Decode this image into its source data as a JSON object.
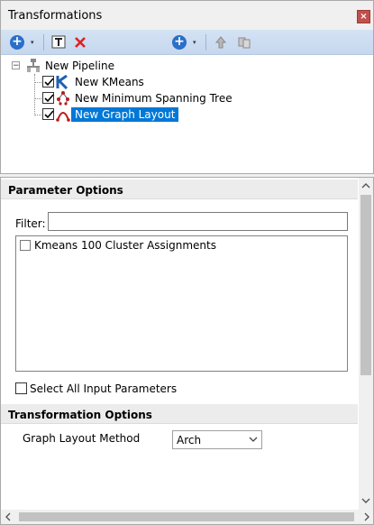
{
  "window": {
    "title": "Transformations",
    "close_glyph": "×"
  },
  "toolbar": {
    "add_glyph": "+",
    "dropdown_glyph": "▾",
    "icons": [
      "add-transformation-icon",
      "rename-icon",
      "delete-icon",
      "add-step-icon",
      "move-up-icon",
      "move-down-icon"
    ]
  },
  "tree": {
    "root": {
      "label": "New Pipeline",
      "expander": "−"
    },
    "items": [
      {
        "label": "New KMeans",
        "checked": true,
        "icon": "kmeans-icon"
      },
      {
        "label": "New Minimum Spanning Tree",
        "checked": true,
        "icon": "mst-icon"
      },
      {
        "label": "New Graph Layout",
        "checked": true,
        "icon": "graph-layout-icon",
        "selected": true
      }
    ]
  },
  "parameter_options": {
    "header": "Parameter Options",
    "filter_label": "Filter:",
    "filter_value": "",
    "list_items": [
      {
        "label": "Kmeans 100 Cluster Assignments",
        "checked": false
      }
    ],
    "select_all_label": "Select All Input Parameters"
  },
  "transformation_options": {
    "header": "Transformation Options",
    "method_label": "Graph Layout Method",
    "method_value": "Arch"
  },
  "colors": {
    "selection": "#0078d7",
    "toolbar": "#c6d7ee",
    "close": "#c0504d",
    "kmeans_blue": "#1f5fb4",
    "mst_red": "#b91c1c"
  }
}
